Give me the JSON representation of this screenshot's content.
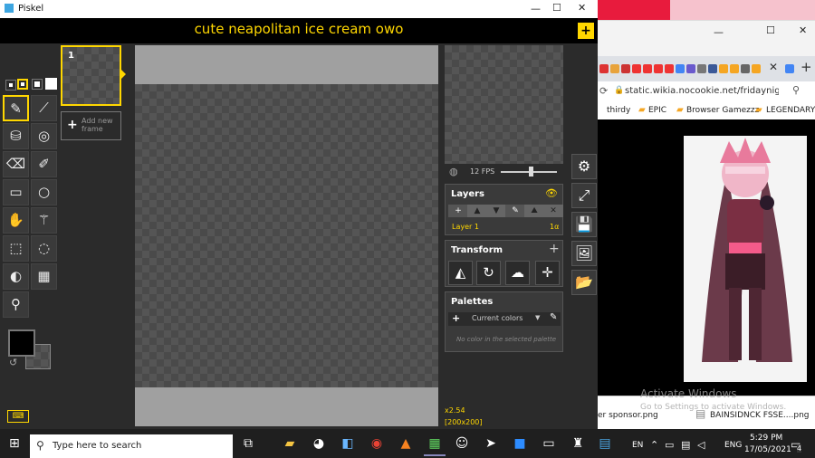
{
  "piskel": {
    "app_title": "Piskel",
    "sprite_title": "cute neapolitan ice cream owo",
    "frame_number": "1",
    "add_frame_label": "Add new frame",
    "fps_label": "12 FPS",
    "fps_value": 12,
    "layers_title": "Layers",
    "layer_name": "Layer 1",
    "layer_opacity": "1α",
    "transform_title": "Transform",
    "palettes_title": "Palettes",
    "palette_select": "Current colors",
    "palette_empty": "No color in the selected palette",
    "zoom": "x2.54",
    "size": "[200x200]",
    "colors": {
      "accent": "#ffd700",
      "primary": "#000000"
    }
  },
  "browser": {
    "url": "static.wikia.nocookie.net/fridaynightfunk...",
    "bookmarks": [
      "thirdy",
      "EPIC",
      "Browser Gamezzz",
      "LEGENDARY"
    ],
    "downloads": [
      "er sponsor.png",
      "BAINSIDNCK FSSE....png"
    ],
    "watermark_line1": "Activate Windows",
    "watermark_line2": "Go to Settings to activate Windows."
  },
  "taskbar": {
    "search_placeholder": "Type here to search",
    "lang1": "EN",
    "lang2": "ENG",
    "time": "5:29 PM",
    "date": "17/05/2021",
    "notif_count": "4"
  },
  "icons": [
    "pen-icon",
    "stroke-icon",
    "bucket-icon",
    "spray-icon",
    "eraser-icon",
    "lighten-icon",
    "rectangle-icon",
    "circle-icon",
    "move-icon",
    "magic-wand-icon",
    "rect-select-icon",
    "lasso-icon",
    "shading-icon",
    "dithering-icon",
    "color-picker-icon",
    "gear-icon",
    "resize-icon",
    "save-icon",
    "image-icon",
    "folder-icon"
  ]
}
